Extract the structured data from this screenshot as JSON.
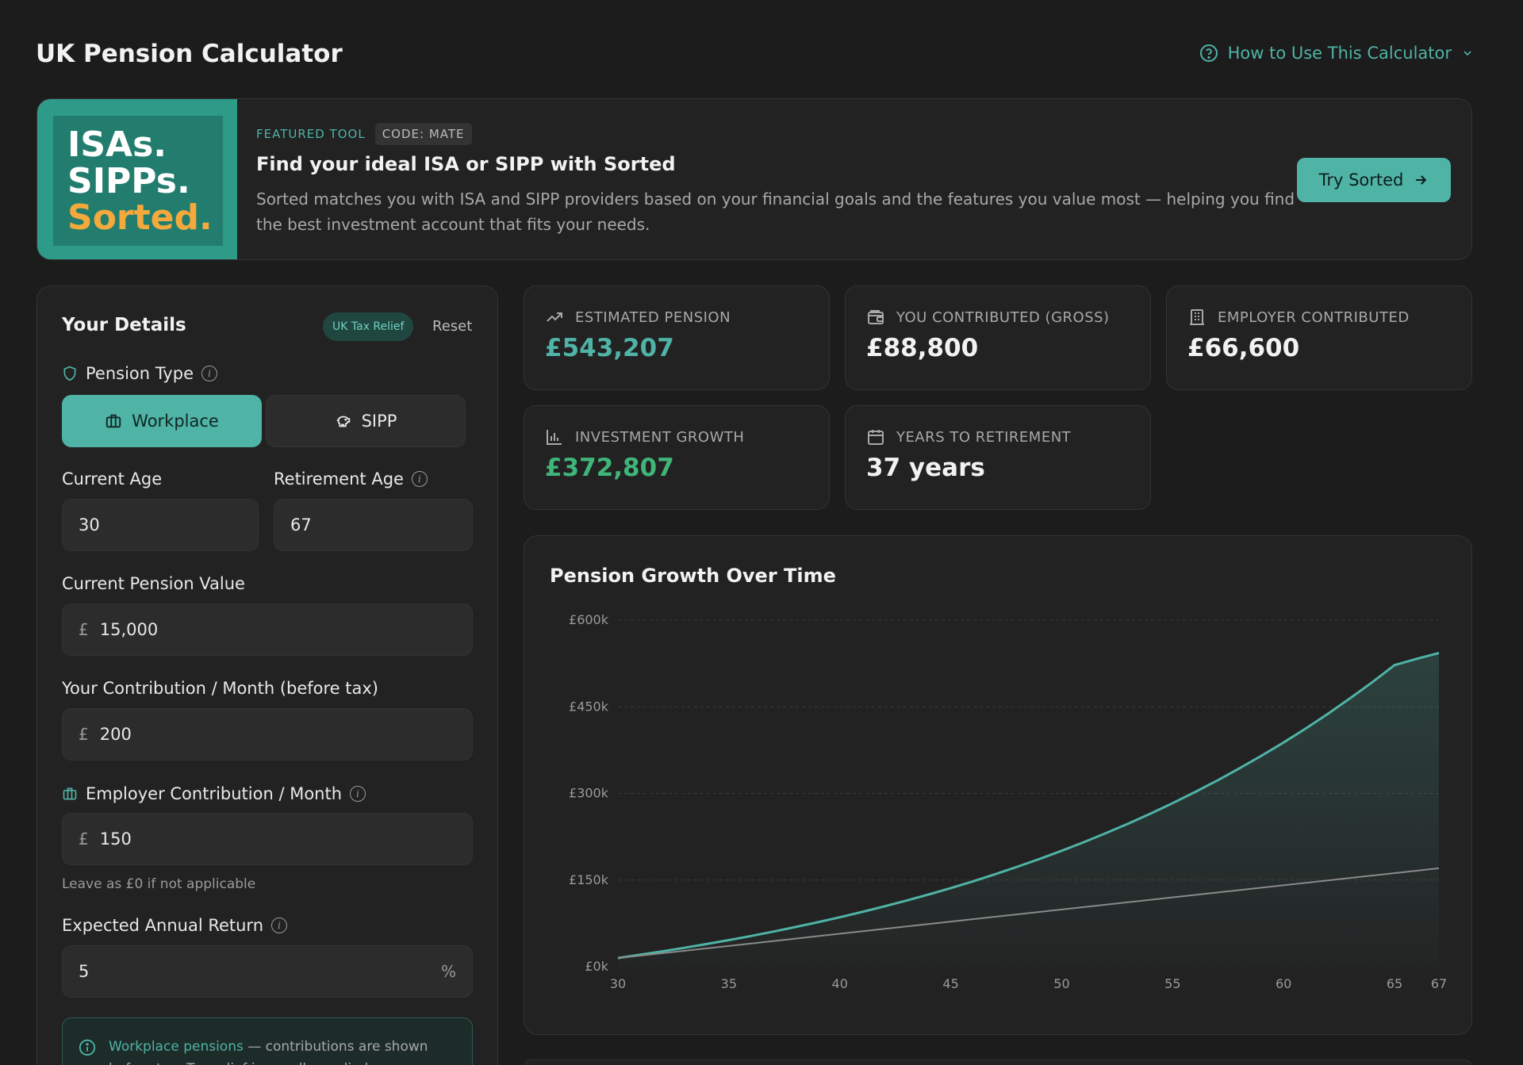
{
  "header": {
    "title": "UK Pension Calculator",
    "howto_label": "How to Use This Calculator"
  },
  "banner": {
    "logo_line1": "ISAs.",
    "logo_line2": "SIPPs.",
    "logo_line3": "Sorted.",
    "tag_featured": "FEATURED TOOL",
    "tag_code": "CODE: MATE",
    "headline": "Find your ideal ISA or SIPP with Sorted",
    "description": "Sorted matches you with ISA and SIPP providers based on your financial goals and the features you value most — helping you find the best investment account that fits your needs.",
    "button_label": "Try Sorted",
    "colors": {
      "logo_bg": "#2e9a88",
      "logo_accent": "#f3a93c",
      "button": "#4fb3a6"
    }
  },
  "details": {
    "title": "Your Details",
    "badge": "UK Tax Relief",
    "reset_label": "Reset",
    "pension_type_label": "Pension Type",
    "options": [
      "Workplace",
      "SIPP"
    ],
    "selected_option": "Workplace",
    "current_age_label": "Current Age",
    "current_age": "30",
    "retirement_age_label": "Retirement Age",
    "retirement_age": "67",
    "pension_value_label": "Current Pension Value",
    "currency_symbol": "£",
    "pension_value": "15,000",
    "contribution_label": "Your Contribution / Month (before tax)",
    "contribution": "200",
    "employer_label": "Employer Contribution / Month",
    "employer": "150",
    "employer_hint": "Leave as £0 if not applicable",
    "return_label": "Expected Annual Return",
    "return_value": "5",
    "percent_symbol": "%",
    "notice_strong": "Workplace pensions",
    "notice_text": " — contributions are shown before tax. Tax relief is usually applied automatically."
  },
  "stats": [
    {
      "label": "ESTIMATED PENSION",
      "value": "£543,207",
      "icon": "trending-up-icon",
      "color": "#4fb3a6"
    },
    {
      "label": "YOU CONTRIBUTED (GROSS)",
      "value": "£88,800",
      "icon": "wallet-icon",
      "color": "#f2f2f2"
    },
    {
      "label": "EMPLOYER CONTRIBUTED",
      "value": "£66,600",
      "icon": "building-icon",
      "color": "#f2f2f2"
    },
    {
      "label": "INVESTMENT GROWTH",
      "value": "£372,807",
      "icon": "bar-chart-icon",
      "color": "#3fb57a"
    },
    {
      "label": "YEARS TO RETIREMENT",
      "value": "37 years",
      "icon": "calendar-icon",
      "color": "#f2f2f2"
    }
  ],
  "chart_data": {
    "type": "area",
    "title": "Pension Growth Over Time",
    "xlabel": "",
    "ylabel": "",
    "x_ticks": [
      30,
      35,
      40,
      45,
      50,
      55,
      60,
      65,
      67
    ],
    "y_ticks": [
      "£0k",
      "£150k",
      "£300k",
      "£450k",
      "£600k"
    ],
    "y_tick_values": [
      0,
      150000,
      300000,
      450000,
      600000
    ],
    "xlim": [
      30,
      67
    ],
    "ylim": [
      0,
      600000
    ],
    "grid": true,
    "series": [
      {
        "name": "",
        "color": "#4fb3a6",
        "fill": true,
        "x": [
          30,
          31,
          32,
          33,
          34,
          35,
          36,
          37,
          38,
          39,
          40,
          41,
          42,
          43,
          44,
          45,
          46,
          47,
          48,
          49,
          50,
          51,
          52,
          53,
          54,
          55,
          56,
          57,
          58,
          59,
          60,
          61,
          62,
          63,
          64,
          65,
          66,
          67
        ],
        "values": [
          15000,
          20700,
          26500,
          32700,
          39200,
          46000,
          53200,
          60700,
          68600,
          76900,
          85600,
          94700,
          104300,
          114400,
          125000,
          136100,
          147800,
          160100,
          173000,
          186500,
          200700,
          215600,
          231300,
          247700,
          265000,
          283100,
          302200,
          322100,
          343100,
          365100,
          388200,
          412500,
          437900,
          464700,
          492700,
          522200,
          533000,
          543207
        ]
      },
      {
        "name": "",
        "color": "#8a8a8a",
        "fill": false,
        "x": [
          30,
          67
        ],
        "values": [
          15000,
          170400
        ]
      }
    ]
  }
}
